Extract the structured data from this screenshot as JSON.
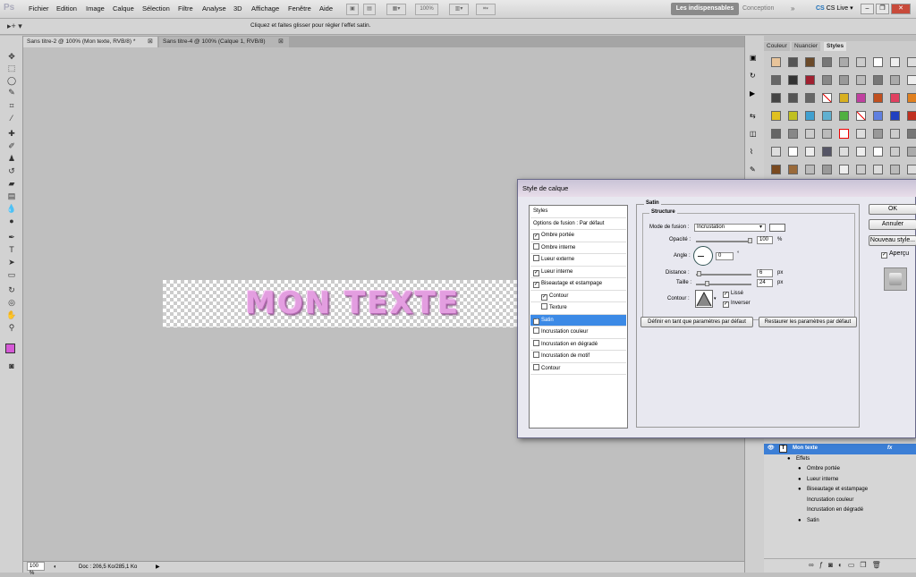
{
  "app": {
    "logo": "Ps"
  },
  "menu": [
    "Fichier",
    "Edition",
    "Image",
    "Calque",
    "Sélection",
    "Filtre",
    "Analyse",
    "3D",
    "Affichage",
    "Fenêtre",
    "Aide"
  ],
  "topbar": {
    "zoom": "100%",
    "essentials": "Les indispensables",
    "conception": "Conception",
    "chevrons": "»",
    "cs_live": "CS Live"
  },
  "options": {
    "hint": "Cliquez et faites glisser pour régler l'effet satin."
  },
  "doc_tabs": [
    {
      "label": "Sans titre-2 @ 100% (Mon texte, RVB/8) *"
    },
    {
      "label": "Sans titre-4 @ 100% (Calque 1, RVB/8)"
    }
  ],
  "canvas": {
    "text": "MON TEXTE"
  },
  "status": {
    "zoom": "100 %",
    "doc": "Doc : 206,5 Ko/285,1 Ko"
  },
  "panel_tabs": [
    "Couleur",
    "Nuancier",
    "Styles"
  ],
  "dialog": {
    "title": "Style de calque",
    "list": [
      {
        "label": "Styles",
        "checked": null,
        "selected": false,
        "indent": false
      },
      {
        "label": "Options de fusion : Par défaut",
        "checked": null,
        "selected": false,
        "indent": false
      },
      {
        "label": "Ombre portée",
        "checked": true,
        "selected": false,
        "indent": false
      },
      {
        "label": "Ombre interne",
        "checked": false,
        "selected": false,
        "indent": false
      },
      {
        "label": "Lueur externe",
        "checked": false,
        "selected": false,
        "indent": false
      },
      {
        "label": "Lueur interne",
        "checked": true,
        "selected": false,
        "indent": false
      },
      {
        "label": "Biseautage et estampage",
        "checked": true,
        "selected": false,
        "indent": false
      },
      {
        "label": "Contour",
        "checked": true,
        "selected": false,
        "indent": true
      },
      {
        "label": "Texture",
        "checked": false,
        "selected": false,
        "indent": true
      },
      {
        "label": "Satin",
        "checked": true,
        "selected": true,
        "indent": false
      },
      {
        "label": "Incrustation couleur",
        "checked": false,
        "selected": false,
        "indent": false
      },
      {
        "label": "Incrustation en dégradé",
        "checked": false,
        "selected": false,
        "indent": false
      },
      {
        "label": "Incrustation de motif",
        "checked": false,
        "selected": false,
        "indent": false
      },
      {
        "label": "Contour",
        "checked": false,
        "selected": false,
        "indent": false
      }
    ],
    "satin": {
      "group": "Satin",
      "structure": "Structure",
      "mode_label": "Mode de fusion :",
      "mode_value": "Incrustation",
      "opacity_label": "Opacité :",
      "opacity_value": "100",
      "percent": "%",
      "angle_label": "Angle :",
      "angle_value": "0",
      "degree": "°",
      "distance_label": "Distance :",
      "distance_value": "6",
      "size_label": "Taille :",
      "size_value": "24",
      "px": "px",
      "contour_label": "Contour :",
      "lisse": "Lissé",
      "inverser": "Inverser",
      "btn_default": "Définir en tant que paramètres par défaut",
      "btn_restore": "Restaurer les paramètres par défaut"
    },
    "buttons": {
      "ok": "OK",
      "cancel": "Annuler",
      "new_style": "Nouveau style...",
      "preview": "Aperçu"
    }
  },
  "layers": [
    {
      "label": "Mon texte",
      "fx": "fx"
    },
    {
      "label": "Effets"
    },
    {
      "label": "Ombre portée"
    },
    {
      "label": "Lueur interne"
    },
    {
      "label": "Biseautage et estampage"
    },
    {
      "label": "Incrustation couleur"
    },
    {
      "label": "Incrustation en dégradé"
    },
    {
      "label": "Satin"
    }
  ]
}
